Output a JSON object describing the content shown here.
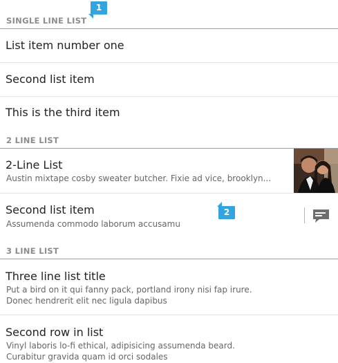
{
  "callouts": [
    "1",
    "2"
  ],
  "single_line": {
    "header": "SINGLE LINE LIST",
    "items": [
      "List item number one",
      "Second list item",
      "This is the third item"
    ]
  },
  "two_line": {
    "header": "2 LINE LIST",
    "items": [
      {
        "title": "2-Line List",
        "subtitle": "Austin mixtape cosby sweater butcher. Fixie ad vice, brooklyn..."
      },
      {
        "title": "Second list item",
        "subtitle": "Assumenda commodo laborum accusamu"
      }
    ]
  },
  "three_line": {
    "header": "3 LINE LIST",
    "items": [
      {
        "title": "Three line list title",
        "line1": "Put a bird on it qui fanny pack, portland irony nisi fap irure.",
        "line2": "Donec hendrerit elit nec ligula dapibus"
      },
      {
        "title": "Second row in list",
        "line1": "Vinyl laboris lo-fi ethical, adipisicing assumenda beard.",
        "line2": "Curabitur gravida quam id orci sodales"
      }
    ]
  },
  "colors": {
    "accent": "#33a4e0",
    "header_text": "#8c8c8c"
  },
  "icons": [
    "message-icon",
    "photo-thumbnail"
  ]
}
